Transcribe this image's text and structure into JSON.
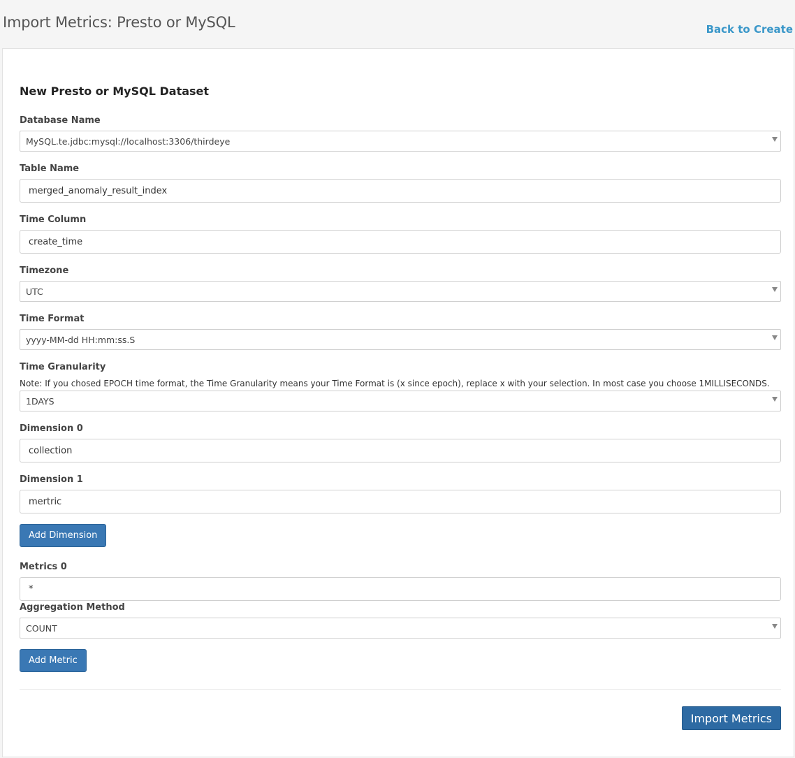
{
  "header": {
    "title": "Import Metrics: Presto or MySQL",
    "back_link": "Back to Create"
  },
  "form": {
    "section_title": "New Presto or MySQL Dataset",
    "database_name": {
      "label": "Database Name",
      "selected": "MySQL.te.jdbc:mysql://localhost:3306/thirdeye"
    },
    "table_name": {
      "label": "Table Name",
      "value": "merged_anomaly_result_index"
    },
    "time_column": {
      "label": "Time Column",
      "value": "create_time"
    },
    "timezone": {
      "label": "Timezone",
      "selected": "UTC"
    },
    "time_format": {
      "label": "Time Format",
      "selected": "yyyy-MM-dd HH:mm:ss.S"
    },
    "time_granularity": {
      "label": "Time Granularity",
      "note": "Note: If you chosed EPOCH time format, the Time Granularity means your Time Format is (x since epoch), replace x with your selection. In most case you choose 1MILLISECONDS.",
      "selected": "1DAYS"
    },
    "dimensions": [
      {
        "label": "Dimension 0",
        "value": "collection"
      },
      {
        "label": "Dimension 1",
        "value": "mertric"
      }
    ],
    "add_dimension_label": "Add Dimension",
    "metrics": [
      {
        "label": "Metrics 0",
        "value": "*",
        "aggregation_label": "Aggregation Method",
        "aggregation_selected": "COUNT"
      }
    ],
    "add_metric_label": "Add Metric",
    "submit_label": "Import Metrics"
  },
  "colors": {
    "link": "#3a97c9",
    "button": "#3a78b4",
    "primary_button": "#2d6aa3"
  }
}
